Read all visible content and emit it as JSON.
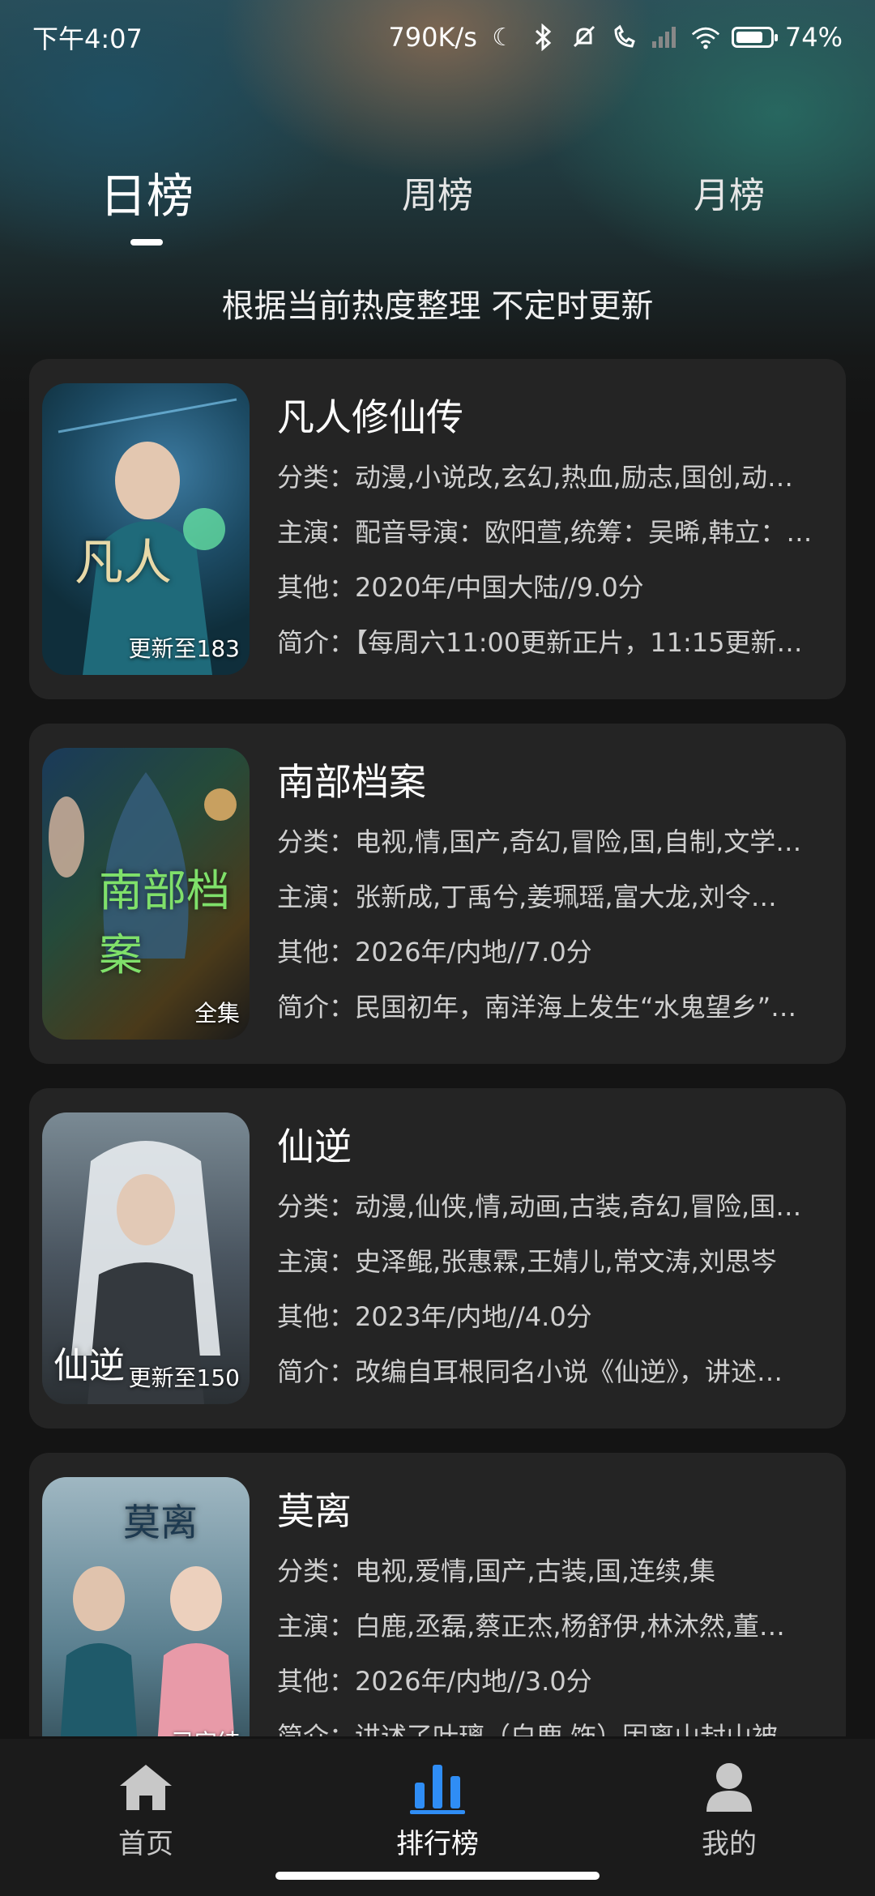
{
  "status": {
    "time": "下午4:07",
    "net_speed": "790K/s",
    "battery": "74%"
  },
  "tabs": [
    {
      "label": "日榜",
      "active": true
    },
    {
      "label": "周榜",
      "active": false
    },
    {
      "label": "月榜",
      "active": false
    }
  ],
  "subtitle": "根据当前热度整理 不定时更新",
  "items": [
    {
      "title": "凡人修仙传",
      "category": "分类：动漫,小说改,玄幻,热血,励志,国创,动…",
      "cast": "主演：配音导演：欧阳萱,统筹：吴晞,韩立：…",
      "other": "其他：2020年/中国大陆//9.0分",
      "intro": "简介：【每周六11:00更新正片，11:15更新下…",
      "badge": "更新至183",
      "poster_text": "凡人"
    },
    {
      "title": "南部档案",
      "category": "分类：电视,情,国产,奇幻,冒险,国,自制,文学…",
      "cast": "主演：张新成,丁禹兮,姜珮瑶,富大龙,刘令…",
      "other": "其他：2026年/内地//7.0分",
      "intro": "简介：民国初年，南洋海上发生“水鬼望乡”…",
      "badge": "全集",
      "poster_text": "南部档案"
    },
    {
      "title": "仙逆",
      "category": "分类：动漫,仙侠,情,动画,古装,奇幻,冒险,国…",
      "cast": "主演：史泽鲲,张惠霖,王婧儿,常文涛,刘思岑",
      "other": "其他：2023年/内地//4.0分",
      "intro": "简介：改编自耳根同名小说《仙逆》，讲述…",
      "badge": "更新至150",
      "poster_text": "仙逆"
    },
    {
      "title": "莫离",
      "category": "分类：电视,爱情,国产,古装,国,连续,集",
      "cast": "主演：白鹿,丞磊,蔡正杰,杨舒伊,林沐然,董…",
      "other": "其他：2026年/内地//3.0分",
      "intro": "简介：讲述了叶璃（白鹿 饰）因离山封山被…",
      "badge": "已完结",
      "poster_text": "莫离"
    }
  ],
  "nav": [
    {
      "label": "首页",
      "icon": "home-icon",
      "active": false
    },
    {
      "label": "排行榜",
      "icon": "ranking-icon",
      "active": true
    },
    {
      "label": "我的",
      "icon": "user-icon",
      "active": false
    }
  ],
  "colors": {
    "accent": "#2f8df5",
    "card_bg": "#242424",
    "page_bg": "#141414"
  }
}
